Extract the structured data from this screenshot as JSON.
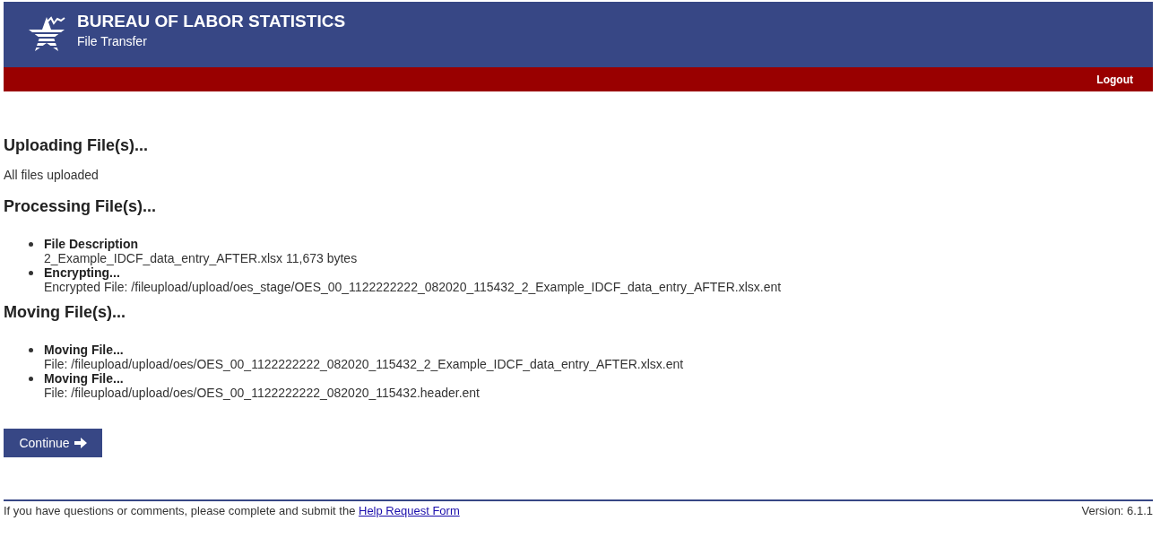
{
  "header": {
    "title": "BUREAU OF LABOR STATISTICS",
    "subtitle": "File Transfer"
  },
  "nav": {
    "logout": "Logout"
  },
  "sections": [
    {
      "heading": "Uploading File(s)...",
      "text": "All files uploaded"
    },
    {
      "heading": "Processing File(s)...",
      "items": [
        {
          "title": "File Description",
          "detail": "2_Example_IDCF_data_entry_AFTER.xlsx 11,673 bytes"
        },
        {
          "title": "Encrypting...",
          "detail": "Encrypted File: /fileupload/upload/oes_stage/OES_00_1122222222_082020_115432_2_Example_IDCF_data_entry_AFTER.xlsx.ent"
        }
      ]
    },
    {
      "heading": "Moving File(s)...",
      "items": [
        {
          "title": "Moving File...",
          "detail": "File: /fileupload/upload/oes/OES_00_1122222222_082020_115432_2_Example_IDCF_data_entry_AFTER.xlsx.ent"
        },
        {
          "title": "Moving File...",
          "detail": "File: /fileupload/upload/oes/OES_00_1122222222_082020_115432.header.ent"
        }
      ]
    }
  ],
  "continue_button": "Continue",
  "footer": {
    "text": "If you have questions or comments, please complete and submit the ",
    "link": "Help Request Form",
    "version": "Version: 6.1.1"
  }
}
